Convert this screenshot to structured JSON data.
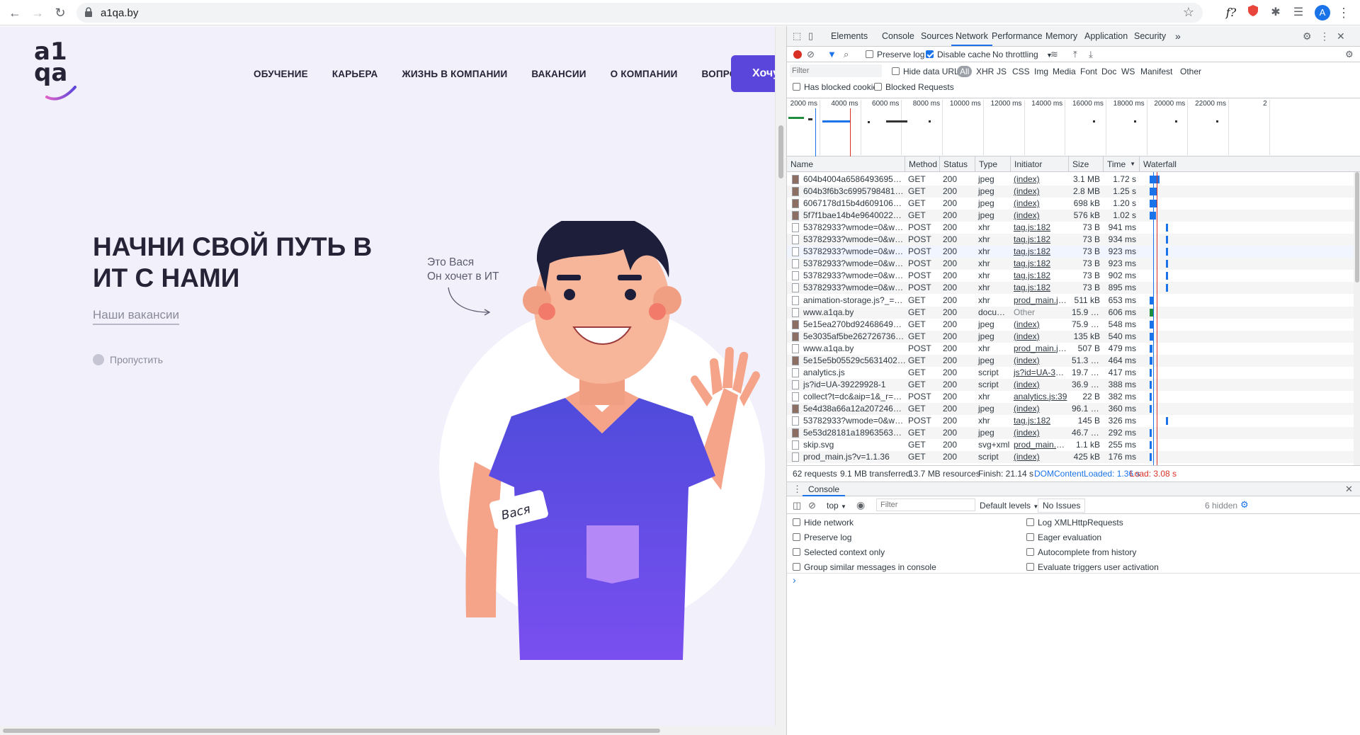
{
  "browser": {
    "url": "a1qa.by",
    "avatar_letter": "A",
    "ext_formula": "f?"
  },
  "site": {
    "logo_top": "a1",
    "logo_bottom": "qa",
    "menu": [
      "ОБУЧЕНИЕ",
      "КАРЬЕРА",
      "ЖИЗНЬ В КОМПАНИИ",
      "ВАКАНСИИ",
      "О КОМПАНИИ",
      "ВОПРОСЫ"
    ],
    "cta_label": "Хочу",
    "hero_line1": "НАЧНИ СВОЙ ПУТЬ В",
    "hero_line2": "ИТ С НАМИ",
    "vacancies_link": "Наши вакансии",
    "skip_label": "Пропустить",
    "note_line1": "Это Вася",
    "note_line2": "Он хочет в ИТ",
    "badge_name": "Вася",
    "accent_color": "#5b46dc"
  },
  "devtools": {
    "tabs": [
      "Elements",
      "Console",
      "Sources",
      "Network",
      "Performance",
      "Memory",
      "Application",
      "Security"
    ],
    "more_tabs": "»",
    "active_tab": "Network",
    "toolbar": {
      "preserve_log": "Preserve log",
      "disable_cache": "Disable cache",
      "throttling": "No throttling"
    },
    "filter_placeholder": "Filter",
    "hide_data_urls": "Hide data URLs",
    "filter_types": [
      "All",
      "XHR",
      "JS",
      "CSS",
      "Img",
      "Media",
      "Font",
      "Doc",
      "WS",
      "Manifest",
      "Other"
    ],
    "has_blocked_cookies": "Has blocked cookies",
    "blocked_requests": "Blocked Requests",
    "timeline_ticks": [
      "2000 ms",
      "4000 ms",
      "6000 ms",
      "8000 ms",
      "10000 ms",
      "12000 ms",
      "14000 ms",
      "16000 ms",
      "18000 ms",
      "20000 ms",
      "22000 ms",
      "2"
    ],
    "columns": [
      "Name",
      "Method",
      "Status",
      "Type",
      "Initiator",
      "Size",
      "Time",
      "Waterfall"
    ],
    "sort_indicator": "▼",
    "requests": [
      {
        "name": "604b4004a6586493695741.jpg",
        "method": "GET",
        "status": "200",
        "type": "jpeg",
        "initiator": "(index)",
        "size": "3.1 MB",
        "time": "1.72 s"
      },
      {
        "name": "604b3f6b3c699579848181.jpg",
        "method": "GET",
        "status": "200",
        "type": "jpeg",
        "initiator": "(index)",
        "size": "2.8 MB",
        "time": "1.25 s"
      },
      {
        "name": "6067178d15b4d609106466.jpg",
        "method": "GET",
        "status": "200",
        "type": "jpeg",
        "initiator": "(index)",
        "size": "698 kB",
        "time": "1.20 s"
      },
      {
        "name": "5f7f1bae14b4e964002278.jpg",
        "method": "GET",
        "status": "200",
        "type": "jpeg",
        "initiator": "(index)",
        "size": "576 kB",
        "time": "1.02 s"
      },
      {
        "name": "53782933?wmode=0&wv-part...",
        "method": "POST",
        "status": "200",
        "type": "xhr",
        "initiator": "tag.js:182",
        "size": "73 B",
        "time": "941 ms"
      },
      {
        "name": "53782933?wmode=0&wv-part...",
        "method": "POST",
        "status": "200",
        "type": "xhr",
        "initiator": "tag.js:182",
        "size": "73 B",
        "time": "934 ms"
      },
      {
        "name": "53782933?wmode=0&wv-part...",
        "method": "POST",
        "status": "200",
        "type": "xhr",
        "initiator": "tag.js:182",
        "size": "73 B",
        "time": "923 ms"
      },
      {
        "name": "53782933?wmode=0&wv-part...",
        "method": "POST",
        "status": "200",
        "type": "xhr",
        "initiator": "tag.js:182",
        "size": "73 B",
        "time": "923 ms"
      },
      {
        "name": "53782933?wmode=0&wv-part...",
        "method": "POST",
        "status": "200",
        "type": "xhr",
        "initiator": "tag.js:182",
        "size": "73 B",
        "time": "902 ms"
      },
      {
        "name": "53782933?wmode=0&wv-part...",
        "method": "POST",
        "status": "200",
        "type": "xhr",
        "initiator": "tag.js:182",
        "size": "73 B",
        "time": "895 ms"
      },
      {
        "name": "animation-storage.js?_=1626...",
        "method": "GET",
        "status": "200",
        "type": "xhr",
        "initiator": "prod_main.js?...",
        "size": "511 kB",
        "time": "653 ms"
      },
      {
        "name": "www.a1qa.by",
        "method": "GET",
        "status": "200",
        "type": "docum...",
        "initiator": "Other",
        "size": "15.9 kB",
        "time": "606 ms"
      },
      {
        "name": "5e15ea270bd92468649850.jpg",
        "method": "GET",
        "status": "200",
        "type": "jpeg",
        "initiator": "(index)",
        "size": "75.9 kB",
        "time": "548 ms"
      },
      {
        "name": "5e3035af5be26272673630.jpg",
        "method": "GET",
        "status": "200",
        "type": "jpeg",
        "initiator": "(index)",
        "size": "135 kB",
        "time": "540 ms"
      },
      {
        "name": "www.a1qa.by",
        "method": "POST",
        "status": "200",
        "type": "xhr",
        "initiator": "prod_main.js?...",
        "size": "507 B",
        "time": "479 ms"
      },
      {
        "name": "5e15e5b05529c563140216.jpg",
        "method": "GET",
        "status": "200",
        "type": "jpeg",
        "initiator": "(index)",
        "size": "51.3 kB",
        "time": "464 ms"
      },
      {
        "name": "analytics.js",
        "method": "GET",
        "status": "200",
        "type": "script",
        "initiator": "js?id=UA-3922...",
        "size": "19.7 kB",
        "time": "417 ms"
      },
      {
        "name": "js?id=UA-39229928-1",
        "method": "GET",
        "status": "200",
        "type": "script",
        "initiator": "(index)",
        "size": "36.9 kB",
        "time": "388 ms"
      },
      {
        "name": "collect?t=dc&aip=1&_r=3&v=...",
        "method": "POST",
        "status": "200",
        "type": "xhr",
        "initiator": "analytics.js:39",
        "size": "22 B",
        "time": "382 ms"
      },
      {
        "name": "5e4d38a66a12a207246800.jpg",
        "method": "GET",
        "status": "200",
        "type": "jpeg",
        "initiator": "(index)",
        "size": "96.1 kB",
        "time": "360 ms"
      },
      {
        "name": "53782933?wmode=0&wv-part...",
        "method": "POST",
        "status": "200",
        "type": "xhr",
        "initiator": "tag.js:182",
        "size": "145 B",
        "time": "326 ms"
      },
      {
        "name": "5e53d28181a18963563605.jpg",
        "method": "GET",
        "status": "200",
        "type": "jpeg",
        "initiator": "(index)",
        "size": "46.7 kB",
        "time": "292 ms"
      },
      {
        "name": "skip.svg",
        "method": "GET",
        "status": "200",
        "type": "svg+xml",
        "initiator": "prod_main.css...",
        "size": "1.1 kB",
        "time": "255 ms"
      },
      {
        "name": "prod_main.js?v=1.1.36",
        "method": "GET",
        "status": "200",
        "type": "script",
        "initiator": "(index)",
        "size": "425 kB",
        "time": "176 ms"
      }
    ],
    "summary": {
      "requests": "62 requests",
      "transferred": "9.1 MB transferred",
      "resources": "13.7 MB resources",
      "finish": "Finish: 21.14 s",
      "dcl": "DOMContentLoaded: 1.36 s",
      "load": "Load: 3.08 s"
    },
    "console": {
      "tab": "Console",
      "context": "top",
      "filter_placeholder": "Filter",
      "levels": "Default levels",
      "issues": "No Issues",
      "hidden": "6 hidden",
      "options_left": [
        "Hide network",
        "Preserve log",
        "Selected context only",
        "Group similar messages in console"
      ],
      "options_right": [
        "Log XMLHttpRequests",
        "Eager evaluation",
        "Autocomplete from history",
        "Evaluate triggers user activation"
      ],
      "prompt": "›"
    }
  }
}
